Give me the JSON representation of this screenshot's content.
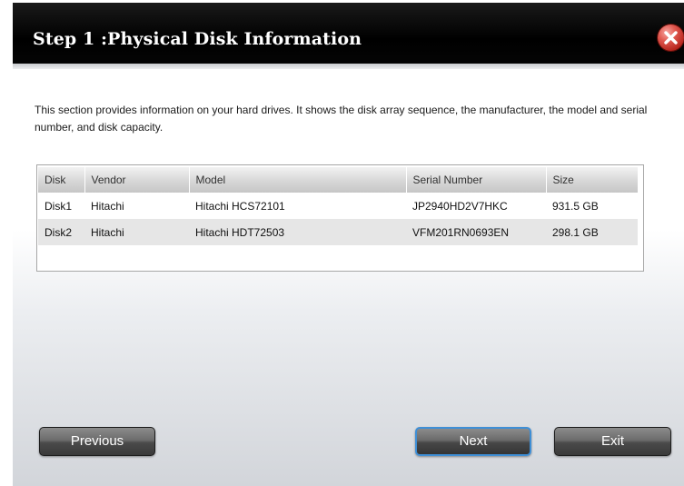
{
  "dialog": {
    "title": "Step 1 :Physical Disk Information",
    "description": "This section provides information on your hard drives. It shows the disk array sequence, the manufacturer, the model and serial number, and disk capacity."
  },
  "table": {
    "headers": [
      "Disk",
      "Vendor",
      "Model",
      "Serial Number",
      "Size"
    ],
    "rows": [
      [
        "Disk1",
        "Hitachi",
        "Hitachi HCS72101",
        "JP2940HD2V7HKC",
        "931.5 GB"
      ],
      [
        "Disk2",
        "Hitachi",
        "Hitachi HDT72503",
        "VFM201RN0693EN",
        "298.1 GB"
      ]
    ]
  },
  "buttons": {
    "previous": "Previous",
    "next": "Next",
    "exit": "Exit"
  },
  "icons": {
    "close": "close-icon"
  },
  "colors": {
    "titlebar": "#000000",
    "close_button": "#c8352c",
    "next_focus_border": "#3f8fd6"
  }
}
